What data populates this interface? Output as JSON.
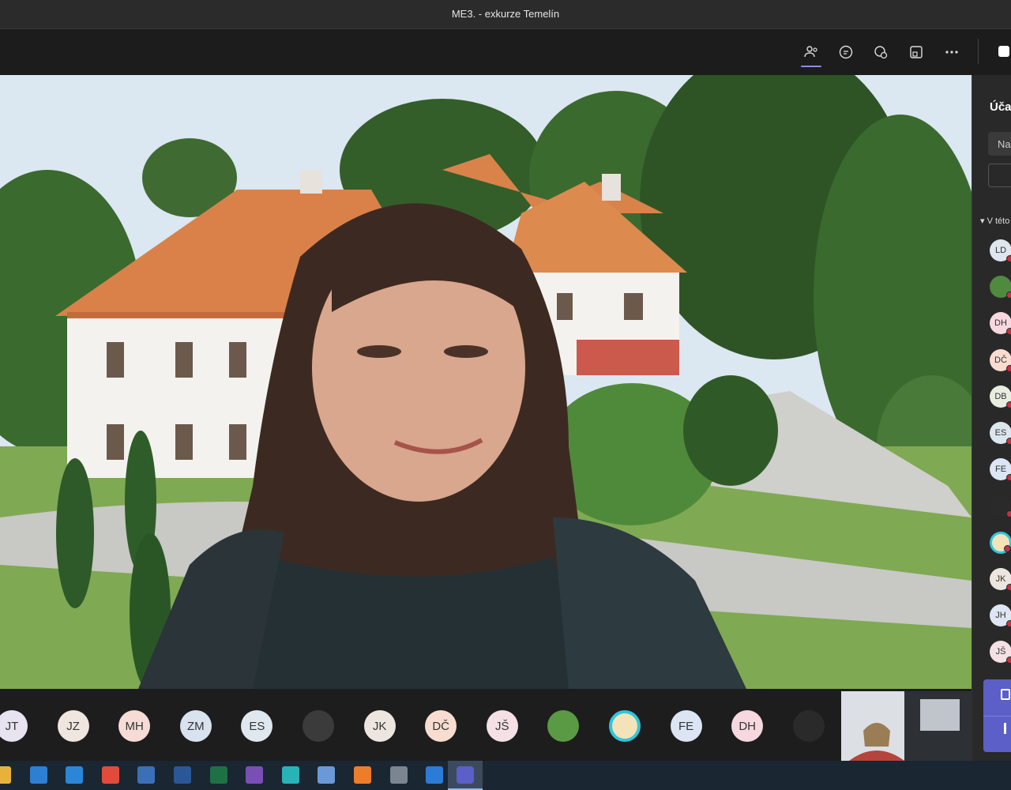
{
  "window": {
    "title": "ME3. - exkurze Temelín"
  },
  "toolbar": {
    "buttons": [
      {
        "name": "participants",
        "icon": "people-icon",
        "active": true
      },
      {
        "name": "chat",
        "icon": "chat-icon"
      },
      {
        "name": "reactions",
        "icon": "react-icon"
      },
      {
        "name": "rooms",
        "icon": "room-icon"
      },
      {
        "name": "more",
        "icon": "more-icon"
      },
      {
        "name": "camera",
        "icon": "camera-icon"
      }
    ]
  },
  "panel": {
    "title": "Účas",
    "search_placeholder": "Na",
    "section": "V této",
    "participants": [
      {
        "initials": "LD",
        "color": "#dfe6ee"
      },
      {
        "initials": "",
        "color": "#4f8a3e",
        "image": "pepe"
      },
      {
        "initials": "DH",
        "color": "#f7d7e0"
      },
      {
        "initials": "DČ",
        "color": "#f8dcd0"
      },
      {
        "initials": "DB",
        "color": "#e7eee0"
      },
      {
        "initials": "ES",
        "color": "#dbe6ee"
      },
      {
        "initials": "FE",
        "color": "#dbe5f4"
      },
      {
        "initials": "",
        "color": "#2a2a2a",
        "image": "dark-photo"
      },
      {
        "initials": "",
        "color": "#2ec6dd",
        "image": "cyan-ring"
      },
      {
        "initials": "JK",
        "color": "#ede6e0"
      },
      {
        "initials": "JH",
        "color": "#dde6f2"
      },
      {
        "initials": "JŠ",
        "color": "#f5e0e6"
      }
    ]
  },
  "strip": {
    "avatars": [
      {
        "initials": "JT",
        "color": "#e7e3f0"
      },
      {
        "initials": "JZ",
        "color": "#efe6e0"
      },
      {
        "initials": "MH",
        "color": "#f7dcd6"
      },
      {
        "initials": "ZM",
        "color": "#d8e3ef"
      },
      {
        "initials": "ES",
        "color": "#dfe8ee"
      },
      {
        "initials": "",
        "color": "#3b3b3b",
        "image": "photo-man"
      },
      {
        "initials": "JK",
        "color": "#ede6e0"
      },
      {
        "initials": "DČ",
        "color": "#f8dcd0"
      },
      {
        "initials": "JŠ",
        "color": "#f5e0e6"
      },
      {
        "initials": "",
        "color": "#4f8a3e",
        "image": "pepe"
      },
      {
        "initials": "",
        "color": "#2ec6dd",
        "image": "cyan-ring"
      },
      {
        "initials": "FE",
        "color": "#dbe5f4"
      },
      {
        "initials": "DH",
        "color": "#f7d7e0"
      },
      {
        "initials": "",
        "color": "#2a2a2a",
        "image": "dark-photo"
      }
    ]
  },
  "taskbar": {
    "apps": [
      {
        "name": "file-explorer",
        "color": "#e8b23a"
      },
      {
        "name": "store",
        "color": "#2d7fd3"
      },
      {
        "name": "mail",
        "color": "#2b86d8"
      },
      {
        "name": "chrome",
        "color": "#e24b3b"
      },
      {
        "name": "remote",
        "color": "#3b6fb8"
      },
      {
        "name": "word",
        "color": "#2b5797"
      },
      {
        "name": "excel",
        "color": "#1e7145"
      },
      {
        "name": "save",
        "color": "#7a4fb5"
      },
      {
        "name": "screen",
        "color": "#27b3b8"
      },
      {
        "name": "paint",
        "color": "#6b98d6"
      },
      {
        "name": "firefox",
        "color": "#ee7d2b"
      },
      {
        "name": "calculator",
        "color": "#7a8591"
      },
      {
        "name": "whiteboard",
        "color": "#2c7bd6"
      },
      {
        "name": "teams",
        "color": "#5b5fc7",
        "active": true
      }
    ]
  }
}
